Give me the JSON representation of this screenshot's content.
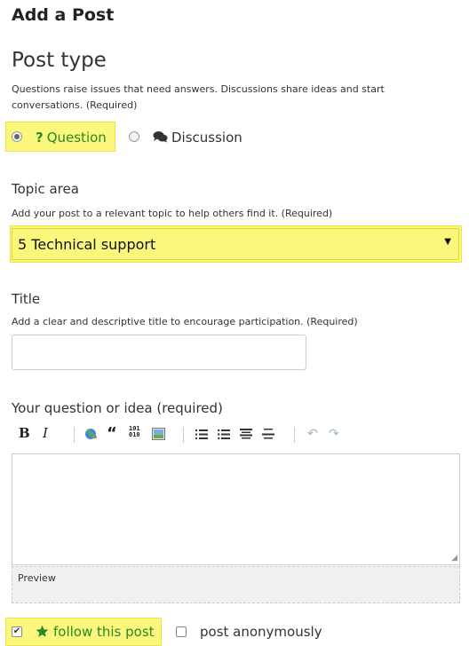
{
  "page": {
    "title": "Add a Post"
  },
  "post_type": {
    "heading": "Post type",
    "help": "Questions raise issues that need answers. Discussions share ideas and start conversations. (Required)",
    "options": [
      {
        "icon": "?",
        "label": "Question",
        "selected": true
      },
      {
        "icon": "comments-icon",
        "label": "Discussion",
        "selected": false
      }
    ]
  },
  "topic_area": {
    "label": "Topic area",
    "help": "Add your post to a relevant topic to help others find it. (Required)",
    "selected": "5 Technical support"
  },
  "title_field": {
    "label": "Title",
    "help": "Add a clear and descriptive title to encourage participation. (Required)",
    "value": ""
  },
  "body_field": {
    "label": "Your question or idea (required)",
    "toolbar": {
      "bold": "B",
      "italic": "I",
      "quote": "“",
      "code": "101\n010"
    },
    "preview_label": "Preview"
  },
  "options": {
    "follow_label": "follow this post",
    "follow_checked": true,
    "anonymous_label": "post anonymously",
    "anonymous_checked": false
  },
  "colors": {
    "highlight": "#fbf77d",
    "accent_green": "#2b8a1f"
  }
}
